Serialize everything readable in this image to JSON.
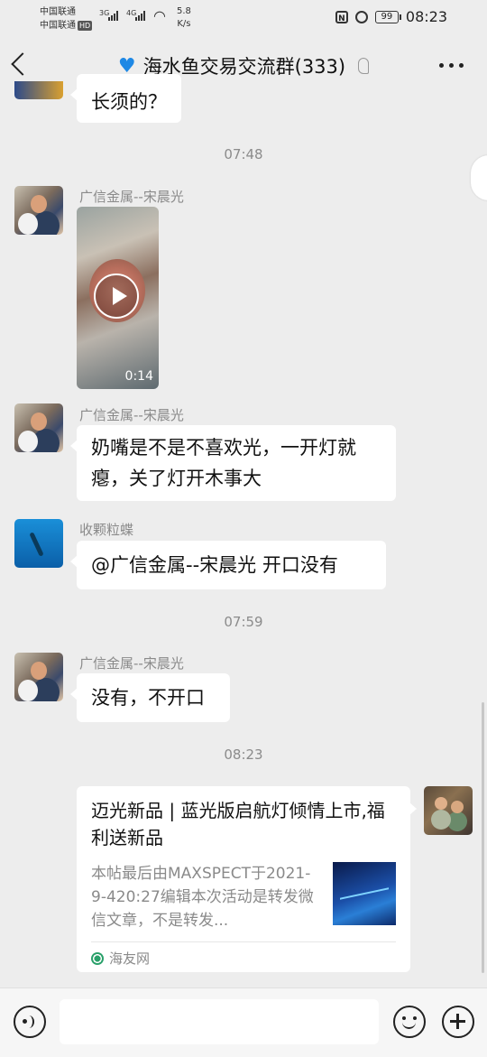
{
  "statusbar": {
    "carrier1": "中国联通",
    "carrier2": "中国联通",
    "hd_badge": "HD",
    "net1": "3G",
    "net2": "4G",
    "speed_value": "5.8",
    "speed_unit": "K/s",
    "battery": "99",
    "time": "08:23"
  },
  "header": {
    "title": "海水鱼交易交流群(333)",
    "heart_icon": "blue-heart-icon"
  },
  "messages": {
    "prev_fragment": "长须的？",
    "time1": "07:48",
    "m1_sender": "广信金属--宋晨光",
    "m1_video_duration": "0:14",
    "m2_sender": "广信金属--宋晨光",
    "m2_text": "奶嘴是不是不喜欢光，一开灯就瘪，关了灯开木事大",
    "m3_sender": "收颗粒蝶",
    "m3_text": "@广信金属--宋晨光  开口没有",
    "time2": "07:59",
    "m4_sender": "广信金属--宋晨光",
    "m4_text": "没有，不开口",
    "time3": "08:23"
  },
  "link_card": {
    "title": "迈光新品 | 蓝光版启航灯倾情上市,福利送新品",
    "description": "本帖最后由MAXSPECT于2021-9-420:27编辑本次活动是转发微信文章，不是转发...",
    "source": "海友网"
  },
  "colors": {
    "background": "#ededed",
    "bubble": "#ffffff",
    "accent_heart": "#1e88e5"
  }
}
